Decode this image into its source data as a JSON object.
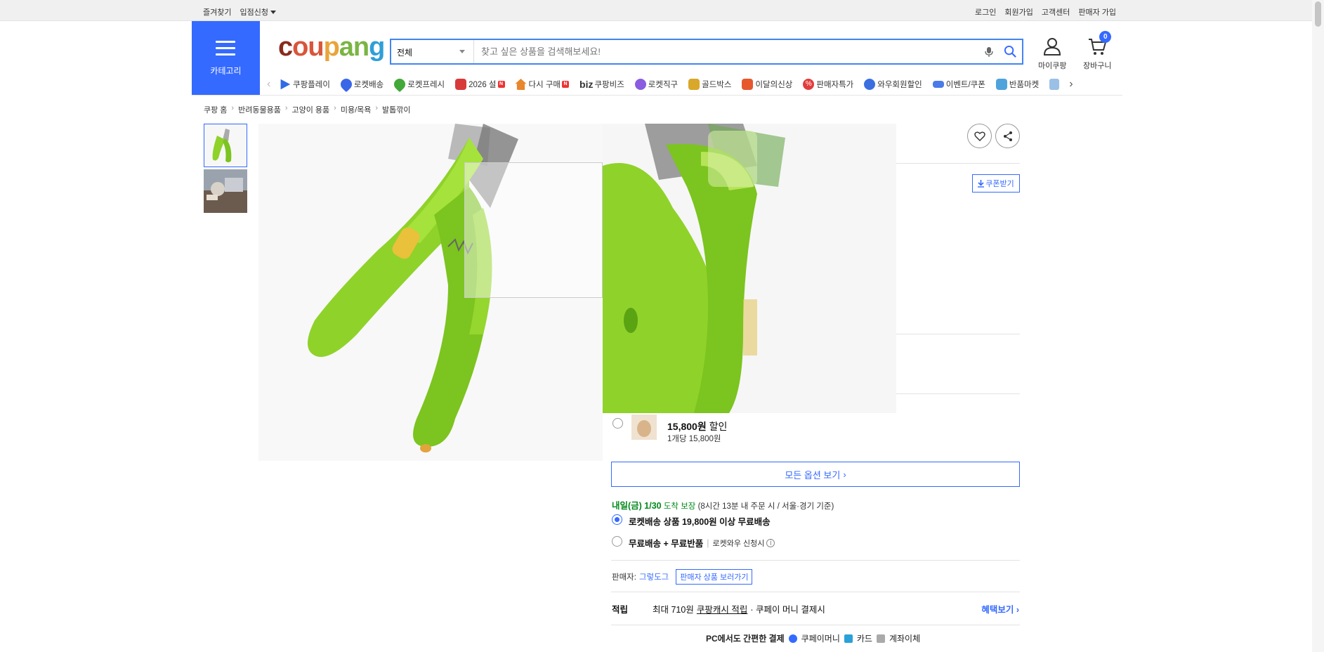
{
  "topbar": {
    "left": [
      "즐겨찾기",
      "입점신청"
    ],
    "right": [
      "로그인",
      "회원가입",
      "고객센터",
      "판매자 가입"
    ]
  },
  "header": {
    "category_label": "카테고리",
    "logo": "coupang",
    "search_scope": "전체",
    "search_placeholder": "찾고 싶은 상품을 검색해보세요!",
    "mycoupang_label": "마이쿠팡",
    "cart_label": "장바구니",
    "cart_count": "0"
  },
  "nav": {
    "items": [
      {
        "label": "쿠팡플레이",
        "color": "#2f6ce5"
      },
      {
        "label": "로켓배송",
        "color": "#3a66e8"
      },
      {
        "label": "로켓프레시",
        "color": "#42a83a"
      },
      {
        "label": "2026 설",
        "color": "#d83a3a",
        "badge": "N"
      },
      {
        "label": "다시 구매",
        "color": "#e8872b",
        "badge": "N"
      },
      {
        "label": "쿠팡비즈",
        "color": "#333333",
        "prefix": "biz"
      },
      {
        "label": "로켓직구",
        "color": "#8a5ce0"
      },
      {
        "label": "골드박스",
        "color": "#d9a72a"
      },
      {
        "label": "이달의신상",
        "color": "#e6572e"
      },
      {
        "label": "판매자특가",
        "color": "#e23c3c"
      },
      {
        "label": "와우회원할인",
        "color": "#3b6fe0"
      },
      {
        "label": "이벤트/쿠폰",
        "color": "#4a7be8"
      },
      {
        "label": "반품마켓",
        "color": "#4fa3dc"
      }
    ]
  },
  "breadcrumb": [
    "쿠팡 홈",
    "반려동물용품",
    "고양이 용품",
    "미용/목욕",
    "발톱깎이"
  ],
  "product": {
    "coupon_label": "쿠폰받기",
    "option_price": "15,800원",
    "option_discount": "할인",
    "option_unit_price": "1개당 15,800원",
    "all_options_label": "모든 옵션 보기",
    "delivery_day": "내일(금) 1/30",
    "delivery_guarantee": "도착 보장",
    "delivery_note": "(8시간 13분 내 주문 시 / 서울·경기 기준)",
    "shipping_option_1": "로켓배송 상품 19,800원 이상 무료배송",
    "shipping_option_2": "무료배송 + 무료반품",
    "shipping_option_2_note": "로켓와우 신청시",
    "seller_label": "판매자:",
    "seller_name": "그렇도그",
    "seller_link": "판매자 상품 보러가기",
    "points_header": "적립",
    "points_max": "최대 710원",
    "points_cash": "쿠팡캐시 적립",
    "points_note": "· 쿠페이 머니 결제시",
    "benefits_link": "혜택보기",
    "pay_headline": "PC에서도 간편한 결제",
    "pay_methods": [
      "쿠페이머니",
      "카드",
      "계좌이체"
    ]
  }
}
